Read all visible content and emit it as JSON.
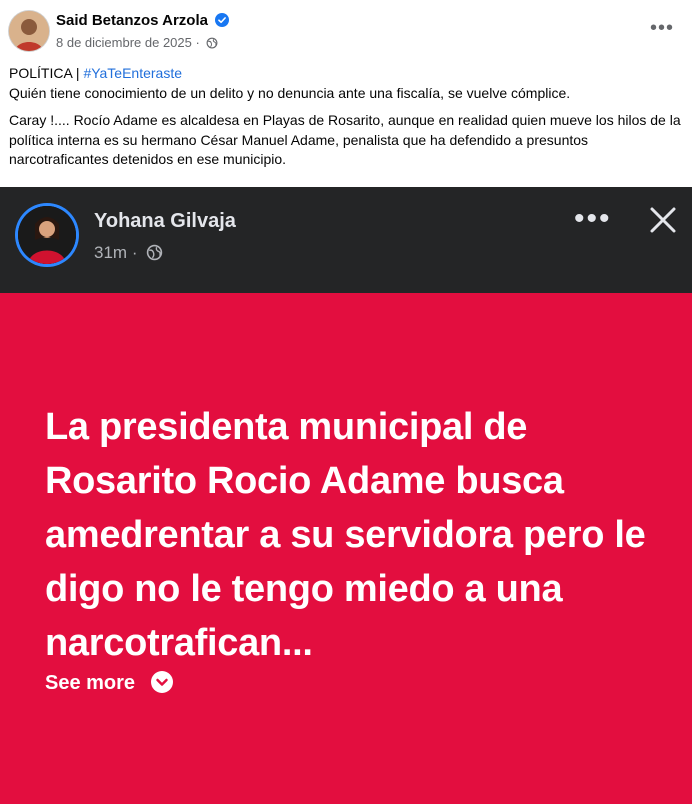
{
  "post": {
    "author": "Said Betanzos Arzola",
    "date": "8 de diciembre de 2025",
    "separator": "·",
    "more_icon": "more-horizontal-icon",
    "tag_prefix": "POLÍTICA | ",
    "hashtag": "#YaTeEnteraste",
    "line1": "Quién tiene conocimiento de un delito y no denuncia ante una fiscalía, se vuelve cómplice.",
    "paragraph2": "Caray !.... Rocío Adame es alcaldesa en Playas de Rosarito, aunque en realidad quien mueve los hilos de la política interna es su hermano César Manuel Adame, penalista que ha defendido a presuntos narcotraficantes detenidos en ese municipio."
  },
  "embed": {
    "author": "Yohana Gilvaja",
    "time": "31m",
    "separator": "·",
    "text": "La presidenta municipal de Rosarito Rocio Adame busca amedrentar a su servidora pero le digo no le tengo miedo a una narcotrafican...",
    "see_more": "See more",
    "background_color": "#e30e3f",
    "header_color": "#242526"
  },
  "colors": {
    "verified": "#1877f2",
    "hashtag": "#216fdb",
    "story_ring": "#2d88ff"
  }
}
